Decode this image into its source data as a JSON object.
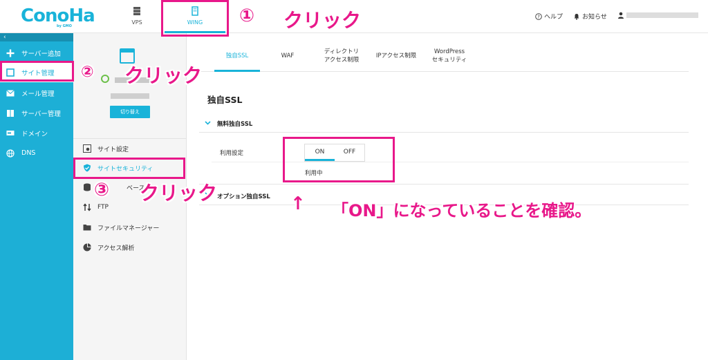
{
  "header": {
    "logo_text": "ConoHa",
    "logo_sub": "by GMO",
    "tabs": [
      {
        "label": "VPS",
        "icon": "server-stack-icon"
      },
      {
        "label": "WING",
        "icon": "wing-building-icon"
      }
    ],
    "help_label": "ヘルプ",
    "notice_label": "お知らせ"
  },
  "sidebar": {
    "collapse_symbol": "‹",
    "items": [
      {
        "label": "サーバー追加",
        "icon": "plus-icon"
      },
      {
        "label": "サイト管理",
        "icon": "site-window-icon"
      },
      {
        "label": "メール管理",
        "icon": "mail-icon"
      },
      {
        "label": "サーバー管理",
        "icon": "server-icon"
      },
      {
        "label": "ドメイン",
        "icon": "domain-icon"
      },
      {
        "label": "DNS",
        "icon": "globe-icon"
      }
    ]
  },
  "panel2": {
    "switch_label": "切り替え",
    "menu": [
      {
        "label": "サイト設定",
        "icon": "settings-window-icon"
      },
      {
        "label": "サイトセキュリティ",
        "icon": "shield-icon"
      },
      {
        "label": "ベース",
        "icon": "database-icon"
      },
      {
        "label": "FTP",
        "icon": "transfer-icon"
      },
      {
        "label": "ファイルマネージャー",
        "icon": "folder-icon"
      },
      {
        "label": "アクセス解析",
        "icon": "pie-chart-icon"
      }
    ]
  },
  "main": {
    "tabs": [
      {
        "label": "独自SSL"
      },
      {
        "label": "WAF"
      },
      {
        "label": "ディレクトリ\nアクセス制限"
      },
      {
        "label": "IPアクセス制限"
      },
      {
        "label": "WordPress\nセキュリティ"
      }
    ],
    "title": "独自SSL",
    "free_ssl_label": "無料独自SSL",
    "setting_label": "利用設定",
    "toggle_on": "ON",
    "toggle_off": "OFF",
    "status": "利用中",
    "option_ssl_label": "オプション独自SSL"
  },
  "annotations": {
    "step1_num": "①",
    "step1_text": "クリック",
    "step2_num": "②",
    "step2_text": "クリック",
    "step3_num": "③",
    "step3_text": "クリック",
    "arrow": "↑",
    "confirm_text": "「ON」になっていることを確認。",
    "color": "#e8188a"
  },
  "colors": {
    "accent": "#19b3d9",
    "sidebar": "#1dafd6"
  }
}
